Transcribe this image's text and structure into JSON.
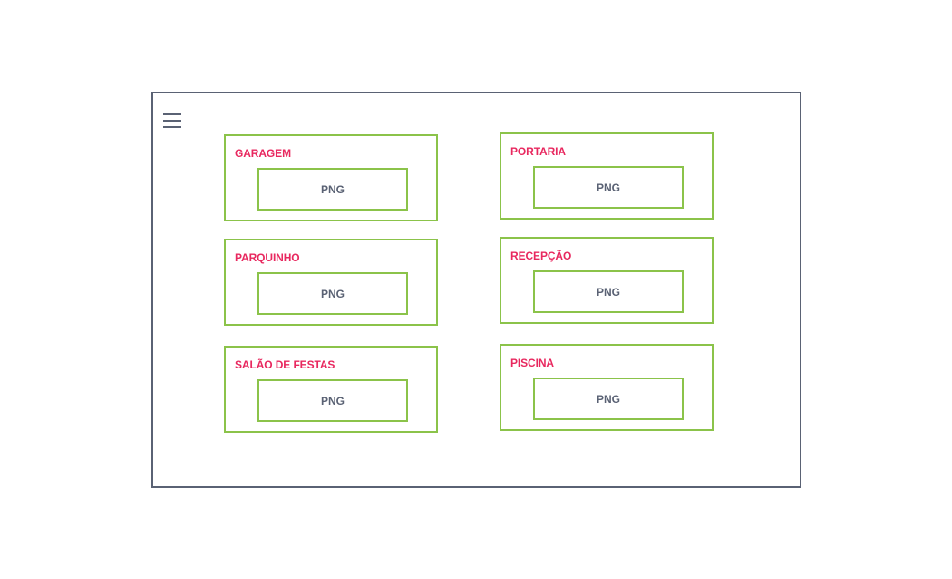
{
  "menu": {
    "icon": "hamburger-menu-icon"
  },
  "colors": {
    "frame_border": "#5a6274",
    "card_border": "#8bc34a",
    "card_title": "#e8285f",
    "image_label": "#5a6274"
  },
  "cards": [
    {
      "title": "GARAGEM",
      "image_label": "PNG"
    },
    {
      "title": "PORTARIA",
      "image_label": "PNG"
    },
    {
      "title": "PARQUINHO",
      "image_label": "PNG"
    },
    {
      "title": "RECEPÇÃO",
      "image_label": "PNG"
    },
    {
      "title": "SALÃO DE FESTAS",
      "image_label": "PNG"
    },
    {
      "title": "PISCINA",
      "image_label": "PNG"
    }
  ]
}
